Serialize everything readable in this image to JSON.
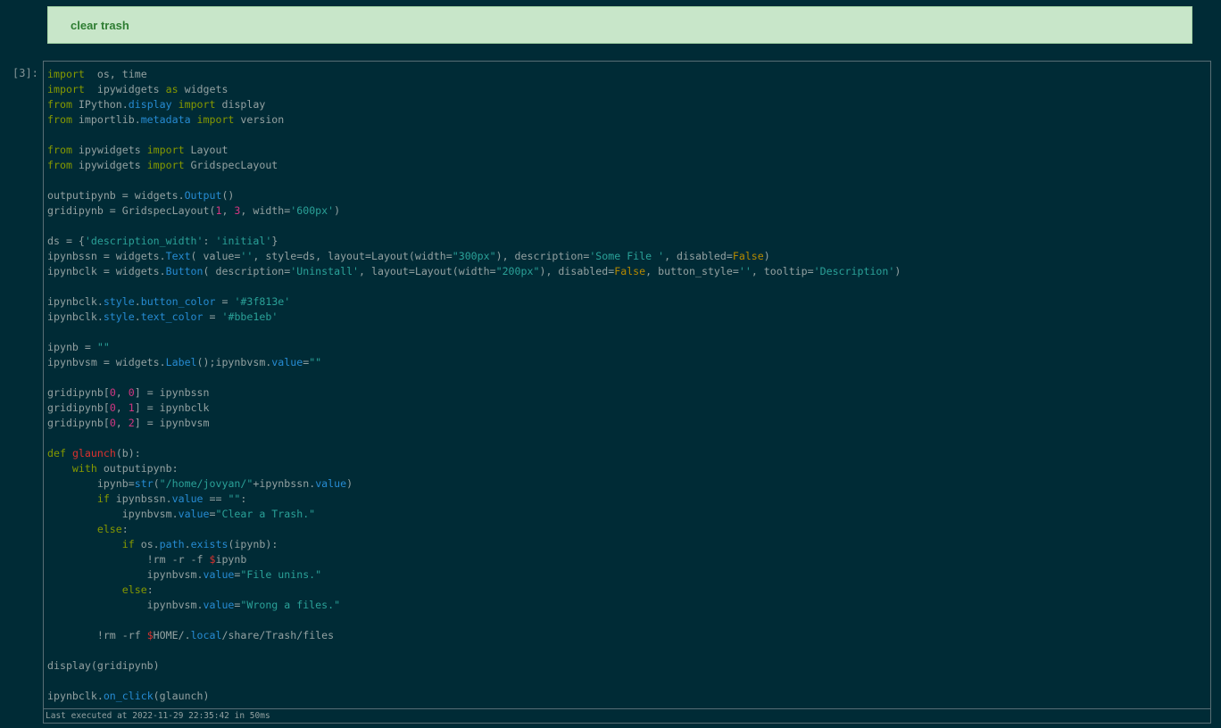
{
  "markdown_cell": {
    "text": "clear trash"
  },
  "code_cell": {
    "prompt": "[3]:",
    "lines": [
      [
        [
          "kw",
          "import"
        ],
        [
          "",
          "  os, time"
        ]
      ],
      [
        [
          "kw",
          "import"
        ],
        [
          "",
          "  ipywidgets "
        ],
        [
          "kw",
          "as"
        ],
        [
          "",
          " widgets"
        ]
      ],
      [
        [
          "kw",
          "from"
        ],
        [
          "",
          " IPython."
        ],
        [
          "at",
          "display"
        ],
        [
          "",
          " "
        ],
        [
          "kw",
          "import"
        ],
        [
          "",
          " display"
        ]
      ],
      [
        [
          "kw",
          "from"
        ],
        [
          "",
          " importlib."
        ],
        [
          "at",
          "metadata"
        ],
        [
          "",
          " "
        ],
        [
          "kw",
          "import"
        ],
        [
          "",
          " version"
        ]
      ],
      [],
      [
        [
          "kw",
          "from"
        ],
        [
          "",
          " ipywidgets "
        ],
        [
          "kw",
          "import"
        ],
        [
          "",
          " Layout"
        ]
      ],
      [
        [
          "kw",
          "from"
        ],
        [
          "",
          " ipywidgets "
        ],
        [
          "kw",
          "import"
        ],
        [
          "",
          " GridspecLayout"
        ]
      ],
      [],
      [
        [
          "",
          "outputipynb = widgets."
        ],
        [
          "at",
          "Output"
        ],
        [
          "",
          "()"
        ]
      ],
      [
        [
          "",
          "gridipynb = GridspecLayout("
        ],
        [
          "nm",
          "1"
        ],
        [
          "",
          ", "
        ],
        [
          "nm",
          "3"
        ],
        [
          "",
          ", width="
        ],
        [
          "st",
          "'600px'"
        ],
        [
          "",
          ")"
        ]
      ],
      [],
      [
        [
          "",
          "ds = {"
        ],
        [
          "st",
          "'description_width'"
        ],
        [
          "",
          ": "
        ],
        [
          "st",
          "'initial'"
        ],
        [
          "",
          "}"
        ]
      ],
      [
        [
          "",
          "ipynbssn = widgets."
        ],
        [
          "at",
          "Text"
        ],
        [
          "",
          "( value="
        ],
        [
          "st",
          "''"
        ],
        [
          "",
          ", style=ds, layout=Layout(width="
        ],
        [
          "st",
          "\"300px\""
        ],
        [
          "",
          "), description="
        ],
        [
          "st",
          "'Some File '"
        ],
        [
          "",
          ", disabled="
        ],
        [
          "bi",
          "False"
        ],
        [
          "",
          ")"
        ]
      ],
      [
        [
          "",
          "ipynbclk = widgets."
        ],
        [
          "at",
          "Button"
        ],
        [
          "",
          "( description="
        ],
        [
          "st",
          "'Uninstall'"
        ],
        [
          "",
          ", layout=Layout(width="
        ],
        [
          "st",
          "\"200px\""
        ],
        [
          "",
          "), disabled="
        ],
        [
          "bi",
          "False"
        ],
        [
          "",
          ", button_style="
        ],
        [
          "st",
          "''"
        ],
        [
          "",
          ", tooltip="
        ],
        [
          "st",
          "'Description'"
        ],
        [
          "",
          ")"
        ]
      ],
      [],
      [
        [
          "",
          "ipynbclk."
        ],
        [
          "at",
          "style"
        ],
        [
          "",
          "."
        ],
        [
          "at",
          "button_color"
        ],
        [
          "",
          " = "
        ],
        [
          "st",
          "'#3f813e'"
        ]
      ],
      [
        [
          "",
          "ipynbclk."
        ],
        [
          "at",
          "style"
        ],
        [
          "",
          "."
        ],
        [
          "at",
          "text_color"
        ],
        [
          "",
          " = "
        ],
        [
          "st",
          "'#bbe1eb'"
        ]
      ],
      [],
      [
        [
          "",
          "ipynb = "
        ],
        [
          "st",
          "\"\""
        ]
      ],
      [
        [
          "",
          "ipynbvsm = widgets."
        ],
        [
          "at",
          "Label"
        ],
        [
          "",
          "();ipynbvsm."
        ],
        [
          "at",
          "value"
        ],
        [
          "",
          "="
        ],
        [
          "st",
          "\"\""
        ]
      ],
      [],
      [
        [
          "",
          "gridipynb["
        ],
        [
          "nm",
          "0"
        ],
        [
          "",
          ", "
        ],
        [
          "nm",
          "0"
        ],
        [
          "",
          "] = ipynbssn"
        ]
      ],
      [
        [
          "",
          "gridipynb["
        ],
        [
          "nm",
          "0"
        ],
        [
          "",
          ", "
        ],
        [
          "nm",
          "1"
        ],
        [
          "",
          "] = ipynbclk"
        ]
      ],
      [
        [
          "",
          "gridipynb["
        ],
        [
          "nm",
          "0"
        ],
        [
          "",
          ", "
        ],
        [
          "nm",
          "2"
        ],
        [
          "",
          "] = ipynbvsm"
        ]
      ],
      [],
      [
        [
          "kw",
          "def"
        ],
        [
          "",
          " "
        ],
        [
          "fn",
          "glaunch"
        ],
        [
          "",
          "(b):"
        ]
      ],
      [
        [
          "",
          "    "
        ],
        [
          "kw",
          "with"
        ],
        [
          "",
          " outputipynb:"
        ]
      ],
      [
        [
          "",
          "        ipynb="
        ],
        [
          "at",
          "str"
        ],
        [
          "",
          "("
        ],
        [
          "st",
          "\"/home/jovyan/\""
        ],
        [
          "",
          "+ipynbssn."
        ],
        [
          "at",
          "value"
        ],
        [
          "",
          ")"
        ]
      ],
      [
        [
          "",
          "        "
        ],
        [
          "kw",
          "if"
        ],
        [
          "",
          " ipynbssn."
        ],
        [
          "at",
          "value"
        ],
        [
          "",
          " == "
        ],
        [
          "st",
          "\"\""
        ],
        [
          "",
          ":"
        ]
      ],
      [
        [
          "",
          "            ipynbvsm."
        ],
        [
          "at",
          "value"
        ],
        [
          "",
          "="
        ],
        [
          "st",
          "\"Clear a Trash.\""
        ]
      ],
      [
        [
          "",
          "        "
        ],
        [
          "kw",
          "else"
        ],
        [
          "",
          ":"
        ]
      ],
      [
        [
          "",
          "            "
        ],
        [
          "kw",
          "if"
        ],
        [
          "",
          " os."
        ],
        [
          "at",
          "path"
        ],
        [
          "",
          "."
        ],
        [
          "at",
          "exists"
        ],
        [
          "",
          "(ipynb):"
        ]
      ],
      [
        [
          "",
          "                !rm -r -f "
        ],
        [
          "dl",
          "$"
        ],
        [
          "",
          "ipynb"
        ]
      ],
      [
        [
          "",
          "                ipynbvsm."
        ],
        [
          "at",
          "value"
        ],
        [
          "",
          "="
        ],
        [
          "st",
          "\"File unins.\""
        ]
      ],
      [
        [
          "",
          "            "
        ],
        [
          "kw",
          "else"
        ],
        [
          "",
          ":"
        ]
      ],
      [
        [
          "",
          "                ipynbvsm."
        ],
        [
          "at",
          "value"
        ],
        [
          "",
          "="
        ],
        [
          "st",
          "\"Wrong a files.\""
        ]
      ],
      [],
      [
        [
          "",
          "        !rm -rf "
        ],
        [
          "dl",
          "$"
        ],
        [
          "",
          "HOME/."
        ],
        [
          "at",
          "local"
        ],
        [
          "",
          "/share/Trash/files"
        ]
      ],
      [],
      [
        [
          "",
          "display(gridipynb)"
        ]
      ],
      [],
      [
        [
          "",
          "ipynbclk."
        ],
        [
          "at",
          "on_click"
        ],
        [
          "",
          "(glaunch)"
        ]
      ]
    ],
    "footer": "Last executed at 2022-11-29 22:35:42 in 50ms"
  }
}
